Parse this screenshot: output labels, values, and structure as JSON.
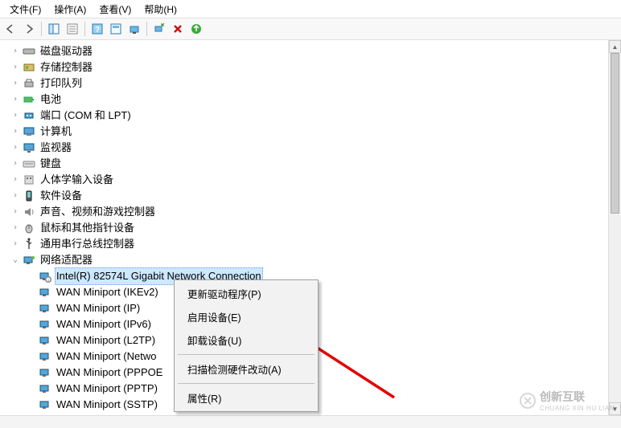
{
  "menubar": {
    "file": "文件(F)",
    "action": "操作(A)",
    "view": "查看(V)",
    "help": "帮助(H)"
  },
  "tree": {
    "disk_drives": "磁盘驱动器",
    "storage_controllers": "存储控制器",
    "print_queues": "打印队列",
    "batteries": "电池",
    "ports": "端口 (COM 和 LPT)",
    "computer": "计算机",
    "monitors": "监视器",
    "keyboards": "键盘",
    "hid": "人体学输入设备",
    "software_devices": "软件设备",
    "audio": "声音、视频和游戏控制器",
    "mice": "鼠标和其他指针设备",
    "usb_controllers": "通用串行总线控制器",
    "network_adapters": "网络适配器",
    "nic_intel": "Intel(R) 82574L Gigabit Network Connection",
    "wan_ikev2": "WAN Miniport (IKEv2)",
    "wan_ip": "WAN Miniport (IP)",
    "wan_ipv6": "WAN Miniport (IPv6)",
    "wan_l2tp": "WAN Miniport (L2TP)",
    "wan_netw": "WAN Miniport (Netwo",
    "wan_pppoe": "WAN Miniport (PPPOE",
    "wan_pptp": "WAN Miniport (PPTP)",
    "wan_sstp": "WAN Miniport (SSTP)"
  },
  "context_menu": {
    "update_driver": "更新驱动程序(P)",
    "enable_device": "启用设备(E)",
    "uninstall_device": "卸载设备(U)",
    "scan_hardware": "扫描检测硬件改动(A)",
    "properties": "属性(R)"
  },
  "watermark": {
    "brand": "创新互联",
    "sub": "CHUANG XIN HU LIAN"
  }
}
